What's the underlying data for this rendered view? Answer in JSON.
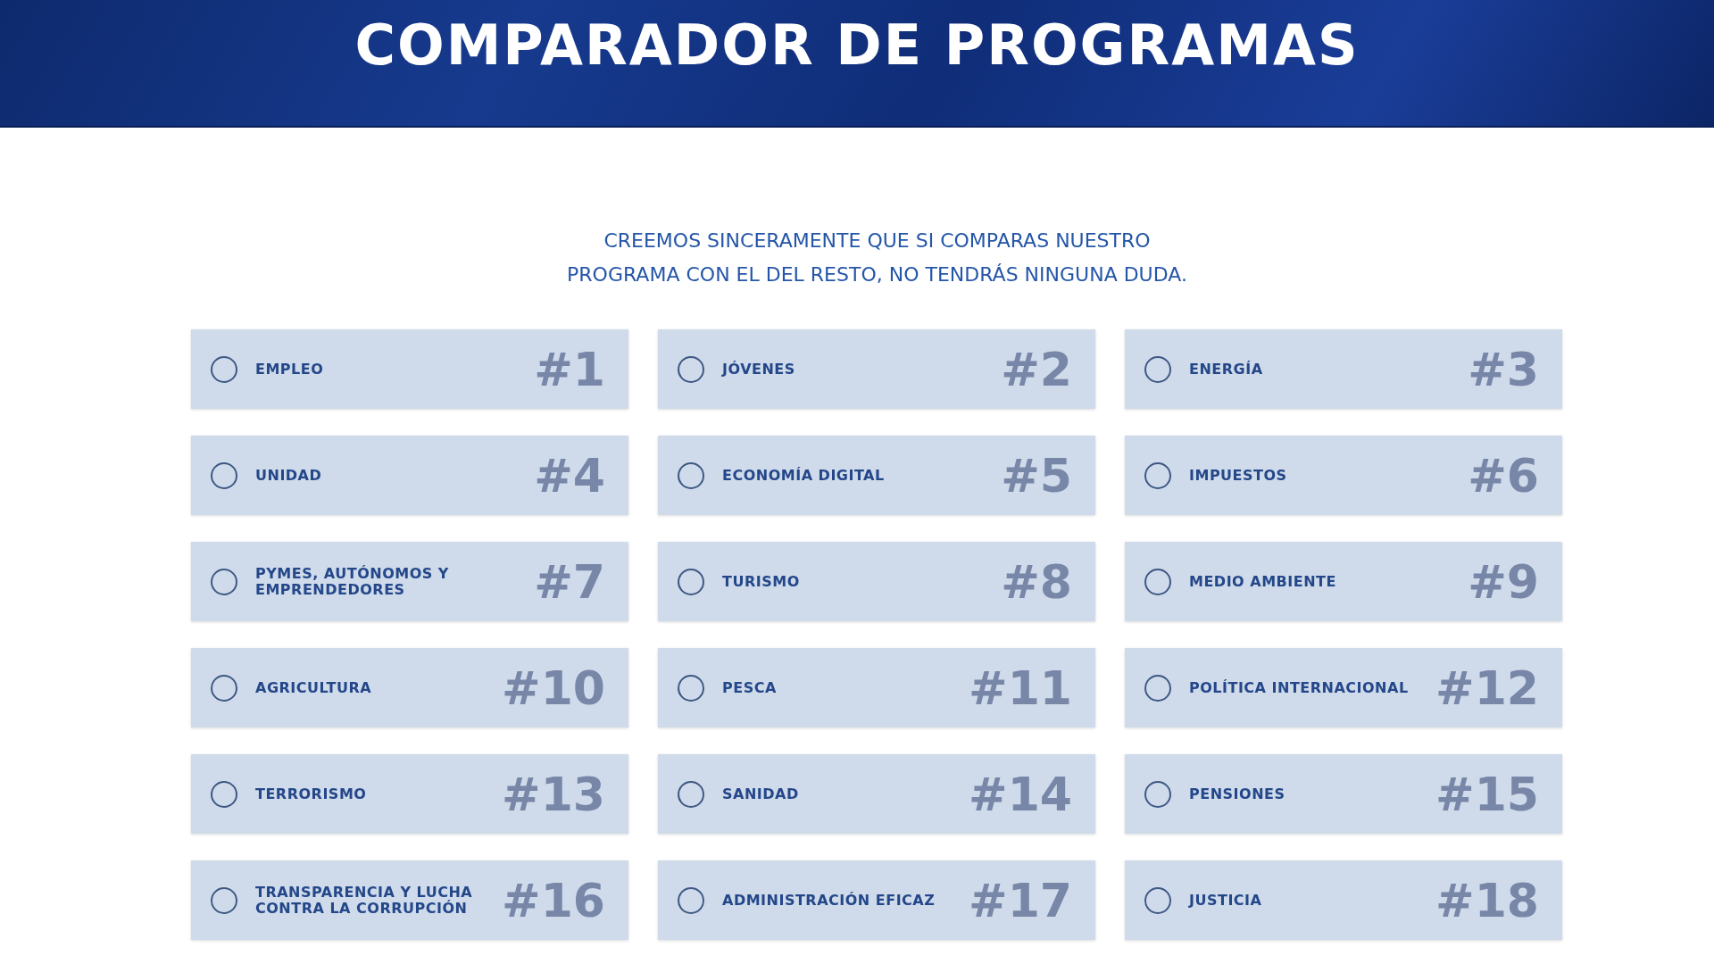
{
  "header": {
    "title": "COMPARADOR DE PROGRAMAS"
  },
  "intro": [
    "CREEMOS SINCERAMENTE QUE SI COMPARAS NUESTRO",
    "PROGRAMA CON EL DEL RESTO, NO TENDRÁS NINGUNA DUDA."
  ],
  "topics": [
    {
      "label": "EMPLEO",
      "number": "#1",
      "selected": false
    },
    {
      "label": "JÓVENES",
      "number": "#2",
      "selected": false
    },
    {
      "label": "ENERGÍA",
      "number": "#3",
      "selected": false
    },
    {
      "label": "UNIDAD",
      "number": "#4",
      "selected": false
    },
    {
      "label": "ECONOMÍA DIGITAL",
      "number": "#5",
      "selected": false
    },
    {
      "label": "IMPUESTOS",
      "number": "#6",
      "selected": false
    },
    {
      "label": "PYMES, AUTÓNOMOS Y EMPRENDEDORES",
      "number": "#7",
      "selected": false
    },
    {
      "label": "TURISMO",
      "number": "#8",
      "selected": false
    },
    {
      "label": "MEDIO AMBIENTE",
      "number": "#9",
      "selected": false
    },
    {
      "label": "AGRICULTURA",
      "number": "#10",
      "selected": false
    },
    {
      "label": "PESCA",
      "number": "#11",
      "selected": false
    },
    {
      "label": "POLÍTICA INTERNACIONAL",
      "number": "#12",
      "selected": false
    },
    {
      "label": "TERRORISMO",
      "number": "#13",
      "selected": false
    },
    {
      "label": "SANIDAD",
      "number": "#14",
      "selected": false
    },
    {
      "label": "PENSIONES",
      "number": "#15",
      "selected": false
    },
    {
      "label": "TRANSPARENCIA Y LUCHA CONTRA LA CORRUPCIÓN",
      "number": "#16",
      "selected": false
    },
    {
      "label": "ADMINISTRACIÓN EFICAZ",
      "number": "#17",
      "selected": false
    },
    {
      "label": "JUSTICIA",
      "number": "#18",
      "selected": false
    }
  ]
}
